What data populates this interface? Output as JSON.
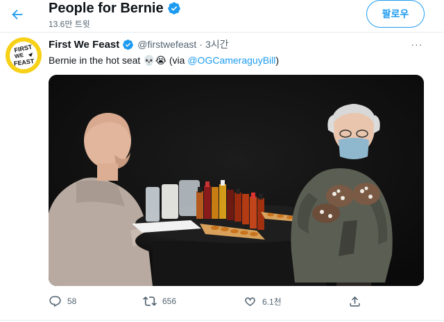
{
  "header": {
    "back_icon": "arrow-left-icon",
    "title": "People for Bernie",
    "subtitle": "13.6만 트윗",
    "follow_label": "팔로우"
  },
  "tweet": {
    "avatar_text": [
      "FIRST",
      "WE",
      "FEAST"
    ],
    "author": "First We Feast",
    "handle": "@firstwefeast",
    "separator": "·",
    "time": "3시간",
    "more_label": "···",
    "text_before": "Bernie in the hot seat ",
    "emojis": "💀😭",
    "text_via": " (via ",
    "mention": "@OGCameraguyBill",
    "text_after": ")"
  },
  "actions": {
    "reply_count": "58",
    "retweet_count": "656",
    "like_count": "6.1천"
  },
  "colors": {
    "accent": "#1d9bf0",
    "text": "#0f1419",
    "muted": "#536471",
    "avatar_bg": "#f7d117"
  }
}
